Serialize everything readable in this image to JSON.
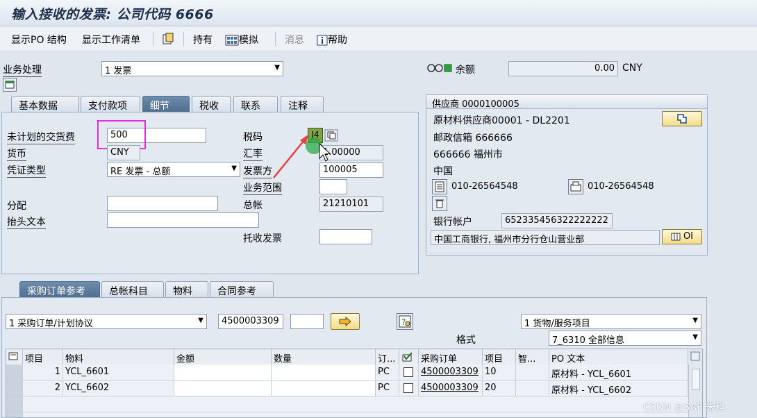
{
  "window": {
    "title": "输入接收的发票: 公司代码 6666"
  },
  "toolbar": {
    "show_po_structure": "显示PO 结构",
    "show_worklist": "显示工作清单",
    "hold": "持有",
    "simulate": "模拟",
    "messages": "消息",
    "help": "帮助"
  },
  "header": {
    "transaction_label": "业务处理",
    "transaction_value": "1 发票",
    "balance_label": "余额",
    "balance_value": "0.00",
    "currency": "CNY"
  },
  "tabs": [
    "基本数据",
    "支付款项",
    "细节",
    "税收",
    "联系",
    "注释"
  ],
  "active_tab": "细节",
  "details": {
    "unplanned_delivery_cost_label": "未计划的交货费",
    "unplanned_delivery_cost_value": "500",
    "currency_label": "货币",
    "currency_value": "CNY",
    "doc_type_label": "凭证类型",
    "doc_type_value": "RE 发票 - 总额",
    "assignment_label": "分配",
    "assignment_value": "",
    "header_text_label": "抬头文本",
    "header_text_value": "",
    "tax_code_label": "税码",
    "tax_code_value": "J4",
    "exchange_rate_label": "汇率",
    "exchange_rate_value": "1.00000",
    "invoicing_party_label": "发票方",
    "invoicing_party_value": "100005",
    "business_area_label": "业务范围",
    "business_area_value": "",
    "gl_account_label": "总帐",
    "gl_account_value": "21210101",
    "collection_invoice_label": "托收发票",
    "collection_invoice_value": ""
  },
  "vendor": {
    "title": "供应商 0000100005",
    "name": "原材料供应商00001 - DL2201",
    "po_box": "邮政信箱 666666",
    "city": "666666 福州市",
    "country": "中国",
    "phone": "010-26564548",
    "fax": "010-26564548",
    "bank_account_label": "银行帐户",
    "bank_account_value": "652335456322222222",
    "bank_name": "中国工商银行, 福州市分行仓山营业部",
    "oi_button": "OI"
  },
  "bottom_tabs": [
    "采购订单参考",
    "总帐科目",
    "物料",
    "合同参考"
  ],
  "active_bottom_tab": "采购订单参考",
  "po_ref": {
    "ref_type": "1 采购订单/计划协议",
    "po_number": "4500003309",
    "item_field": "",
    "item_type": "1 货物/服务项目",
    "layout_label": "格式",
    "layout_value": "7_6310 全部信息"
  },
  "table": {
    "columns": [
      "项目",
      "物料",
      "金额",
      "数量",
      "订...",
      "",
      "采购订单",
      "项目",
      "智...",
      "PO 文本"
    ],
    "rows": [
      {
        "item": "1",
        "material": "YCL_6601",
        "amount": "",
        "qty": "",
        "unit": "PC",
        "po": "4500003309",
        "po_item": "10",
        "text": "原材料 - YCL_6601"
      },
      {
        "item": "2",
        "material": "YCL_6602",
        "amount": "",
        "qty": "",
        "unit": "PC",
        "po": "4500003309",
        "po_item": "20",
        "text": "原材料 - YCL_6602"
      }
    ]
  },
  "watermark": "CSDN @SAP 朱科",
  "colors": {
    "highlight": "#e02ee0",
    "arrow": "#e8413c",
    "tab_active": "#5b7899"
  }
}
